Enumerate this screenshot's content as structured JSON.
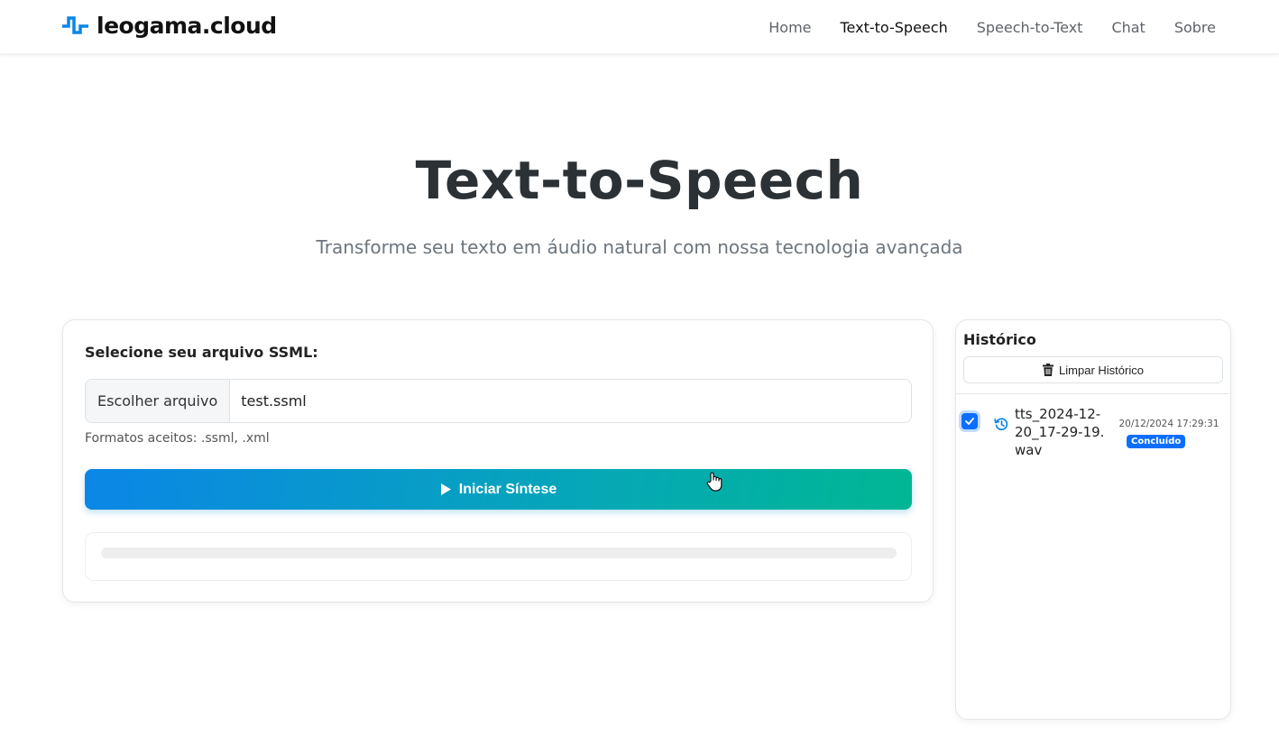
{
  "brand": {
    "name": "leogama.cloud",
    "icon": "pulse-wave-icon",
    "accent": "#0b86e6"
  },
  "nav": {
    "items": [
      {
        "label": "Home",
        "active": false
      },
      {
        "label": "Text-to-Speech",
        "active": true
      },
      {
        "label": "Speech-to-Text",
        "active": false
      },
      {
        "label": "Chat",
        "active": false
      },
      {
        "label": "Sobre",
        "active": false
      }
    ]
  },
  "hero": {
    "title": "Text-to-Speech",
    "subtitle": "Transforme seu texto em áudio natural com nossa tecnologia avançada"
  },
  "form": {
    "label": "Selecione seu arquivo SSML:",
    "choose_button": "Escolher arquivo",
    "file_name": "test.ssml",
    "hint": "Formatos aceitos: .ssml, .xml",
    "start_button": "Iniciar Síntese",
    "progress": 0
  },
  "history": {
    "title": "Histórico",
    "clear_button": "Limpar Histórico",
    "items": [
      {
        "file": "tts_2024-12-20_17-29-19.wav",
        "date": "20/12/2024 17:29:31",
        "status": "Concluído",
        "checked": true
      }
    ]
  },
  "colors": {
    "gradient_start": "#0b86e6",
    "gradient_end": "#00b793",
    "badge": "#0d6efd"
  }
}
